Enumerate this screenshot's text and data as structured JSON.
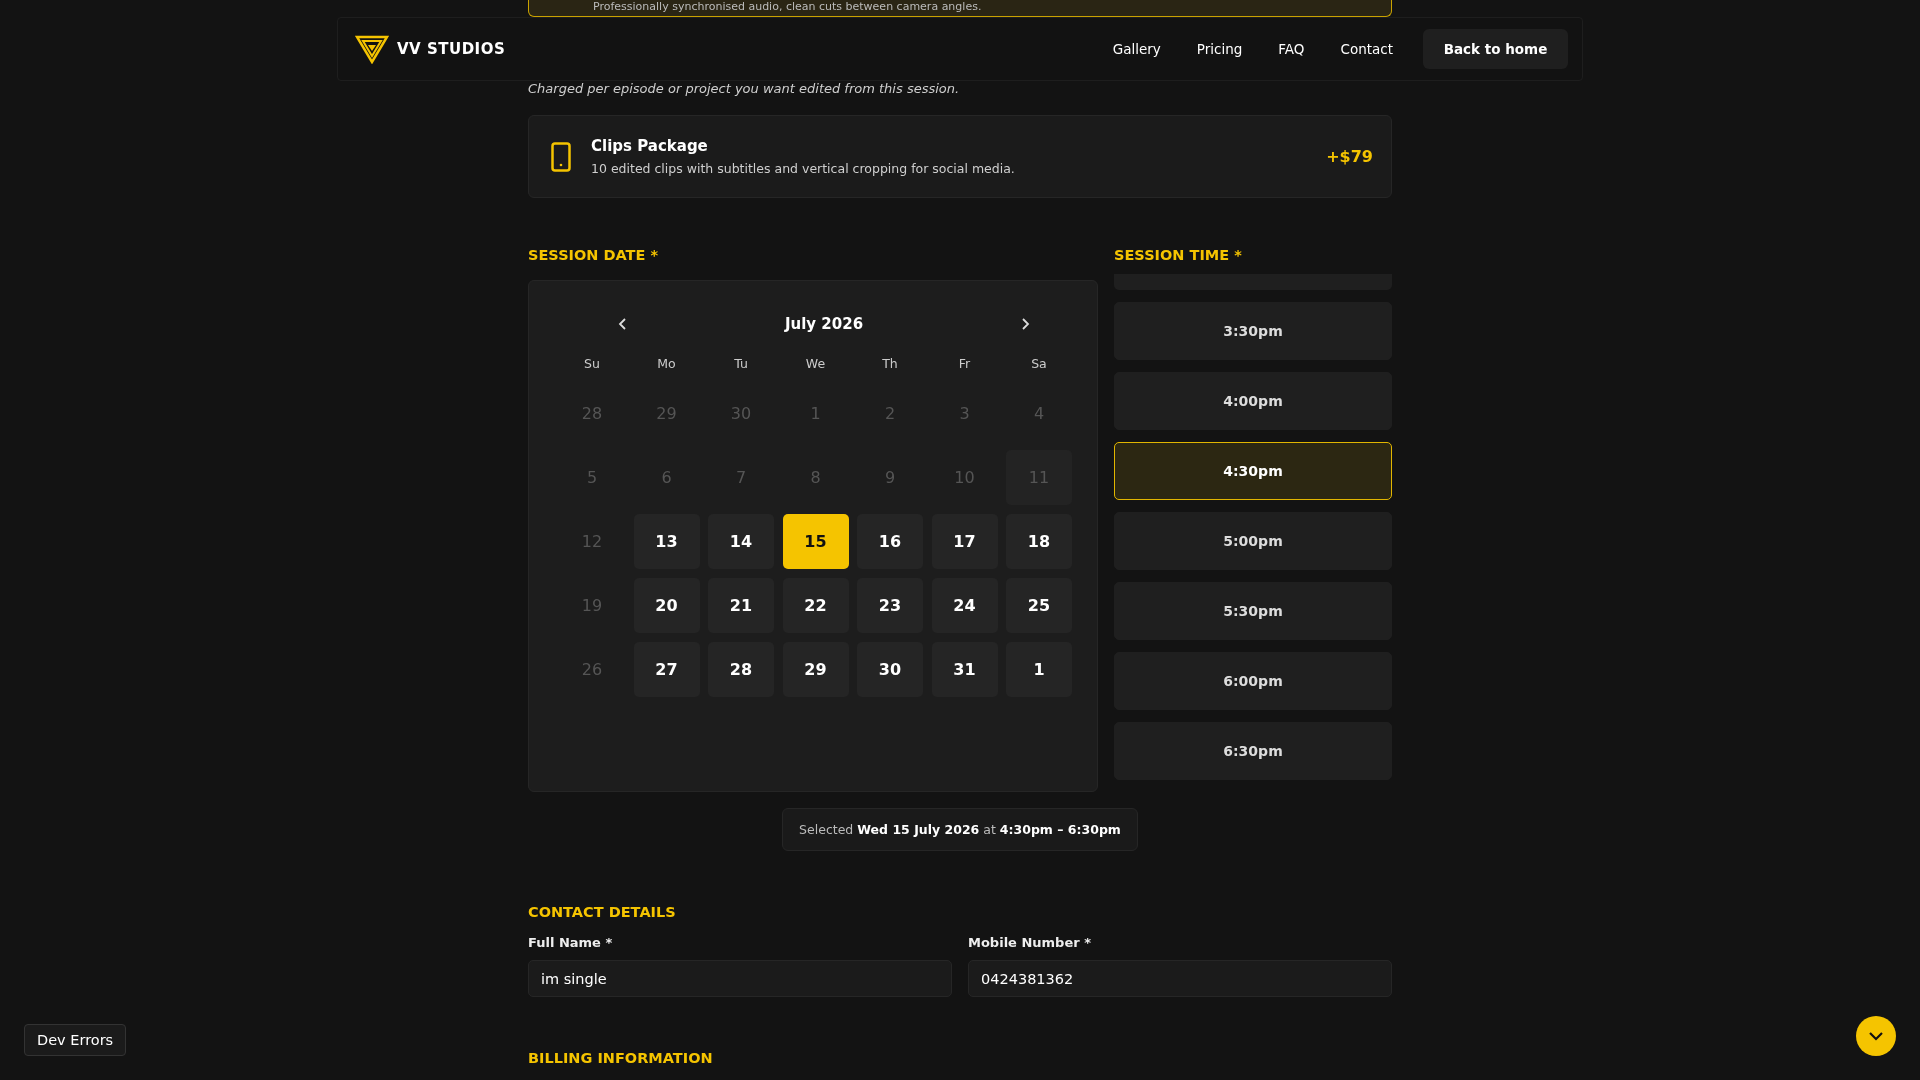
{
  "previous_option": {
    "description": "Professionally synchronised audio, clean cuts between camera angles.",
    "selected": true
  },
  "header": {
    "brand": "VV STUDIOS",
    "nav": [
      "Gallery",
      "Pricing",
      "FAQ",
      "Contact"
    ],
    "button": "Back to home"
  },
  "edits_note": "Charged per episode or project you want edited from this session.",
  "addon": {
    "title": "Clips Package",
    "description": "10 edited clips with subtitles and vertical cropping for social media.",
    "price": "+$79",
    "selected": false
  },
  "session_date": {
    "label": "SESSION DATE *",
    "month": "July 2026",
    "weekdays": [
      "Su",
      "Mo",
      "Tu",
      "We",
      "Th",
      "Fr",
      "Sa"
    ],
    "days": [
      {
        "label": "28",
        "kind": "muted",
        "selected": false
      },
      {
        "label": "29",
        "kind": "muted",
        "selected": false
      },
      {
        "label": "30",
        "kind": "muted",
        "selected": false
      },
      {
        "label": "1",
        "kind": "muted",
        "selected": false
      },
      {
        "label": "2",
        "kind": "muted",
        "selected": false
      },
      {
        "label": "3",
        "kind": "muted",
        "selected": false
      },
      {
        "label": "4",
        "kind": "muted",
        "selected": false
      },
      {
        "label": "5",
        "kind": "muted",
        "selected": false
      },
      {
        "label": "6",
        "kind": "muted",
        "selected": false
      },
      {
        "label": "7",
        "kind": "muted",
        "selected": false
      },
      {
        "label": "8",
        "kind": "muted",
        "selected": false
      },
      {
        "label": "9",
        "kind": "muted",
        "selected": false
      },
      {
        "label": "10",
        "kind": "muted",
        "selected": false
      },
      {
        "label": "11",
        "kind": "blocked",
        "selected": false
      },
      {
        "label": "12",
        "kind": "muted",
        "selected": false
      },
      {
        "label": "13",
        "kind": "open",
        "selected": false
      },
      {
        "label": "14",
        "kind": "open",
        "selected": false
      },
      {
        "label": "15",
        "kind": "open",
        "selected": true
      },
      {
        "label": "16",
        "kind": "open",
        "selected": false
      },
      {
        "label": "17",
        "kind": "open",
        "selected": false
      },
      {
        "label": "18",
        "kind": "open",
        "selected": false
      },
      {
        "label": "19",
        "kind": "muted",
        "selected": false
      },
      {
        "label": "20",
        "kind": "open",
        "selected": false
      },
      {
        "label": "21",
        "kind": "open",
        "selected": false
      },
      {
        "label": "22",
        "kind": "open",
        "selected": false
      },
      {
        "label": "23",
        "kind": "open",
        "selected": false
      },
      {
        "label": "24",
        "kind": "open",
        "selected": false
      },
      {
        "label": "25",
        "kind": "open",
        "selected": false
      },
      {
        "label": "26",
        "kind": "muted",
        "selected": false
      },
      {
        "label": "27",
        "kind": "open",
        "selected": false
      },
      {
        "label": "28",
        "kind": "open",
        "selected": false
      },
      {
        "label": "29",
        "kind": "open",
        "selected": false
      },
      {
        "label": "30",
        "kind": "open",
        "selected": false
      },
      {
        "label": "31",
        "kind": "open",
        "selected": false
      },
      {
        "label": "1",
        "kind": "open",
        "selected": false
      }
    ]
  },
  "session_time": {
    "label": "SESSION TIME *",
    "slots": [
      {
        "label": "3:30pm",
        "selected": false
      },
      {
        "label": "4:00pm",
        "selected": false
      },
      {
        "label": "4:30pm",
        "selected": true
      },
      {
        "label": "5:00pm",
        "selected": false
      },
      {
        "label": "5:30pm",
        "selected": false
      },
      {
        "label": "6:00pm",
        "selected": false
      },
      {
        "label": "6:30pm",
        "selected": false
      }
    ]
  },
  "summary": "Selected **Wed 15 July 2026** at **4:30pm – 6:30pm**",
  "contact": {
    "heading": "CONTACT DETAILS",
    "fields": [
      {
        "label": "Full Name *",
        "value": "im single"
      },
      {
        "label": "Mobile Number *",
        "value": "0424381362"
      }
    ]
  },
  "billing": {
    "heading": "BILLING INFORMATION"
  },
  "dev_button": "Dev Errors"
}
